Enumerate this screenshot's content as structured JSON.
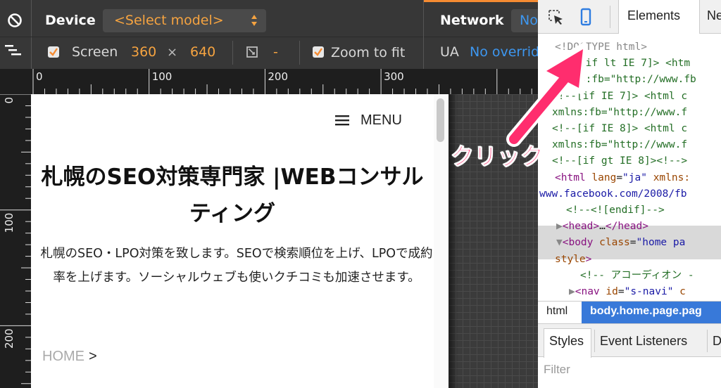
{
  "toolbar": {
    "device_label": "Device",
    "model_select": "<Select model>",
    "screen_label": "Screen",
    "screen_width": "360",
    "times": "×",
    "screen_height": "640",
    "scale_value": "-",
    "zoom_label": "Zoom to fit",
    "network_label": "Network",
    "network_value": "No",
    "ua_label": "UA",
    "ua_value": "No overrid",
    "icons": [
      "block-icon",
      "emulation-icon",
      "checkbox-icon",
      "zoom-icon"
    ]
  },
  "ruler": {
    "top_ticks": [
      "0",
      "100",
      "200",
      "300"
    ],
    "left_ticks": [
      "0",
      "100",
      "200"
    ]
  },
  "page": {
    "menu_label": "MENU",
    "title": "札幌のSEO対策専門家 |WEBコンサルティング",
    "description": "札幌のSEO・LPO対策を致します。SEOで検索順位を上げ、LPOで成約率を上げます。ソーシャルウェブも使いクチコミも加速させます。",
    "breadcrumb_home": "HOME",
    "breadcrumb_sep": ">"
  },
  "devtools": {
    "tab_elements": "Elements",
    "tab_network": "Ne",
    "code_lines": [
      {
        "parts": [
          [
            "c-gray",
            "<!DOCTYPE html>"
          ]
        ]
      },
      {
        "parts": [
          [
            "c-comment",
            "<!--[if lt IE 7]> <htm"
          ]
        ]
      },
      {
        "parts": [
          [
            "c-comment",
            "xmlns:fb=\"http://www.fb"
          ]
        ]
      },
      {
        "parts": [
          [
            "c-comment",
            "<!--[if IE 7]> <html c"
          ]
        ]
      },
      {
        "parts": [
          [
            "c-comment",
            "xmlns:fb=\"http://www.f"
          ]
        ]
      },
      {
        "parts": [
          [
            "c-comment",
            "<!--[if IE 8]> <html c"
          ]
        ]
      },
      {
        "parts": [
          [
            "c-comment",
            "xmlns:fb=\"http://www.f"
          ]
        ]
      },
      {
        "parts": [
          [
            "c-comment",
            "<!--[if gt IE 8]><!-->"
          ]
        ]
      },
      {
        "parts": [
          [
            "c-tag",
            "<html "
          ],
          [
            "c-attr",
            "lang"
          ],
          [
            "c-text",
            "="
          ],
          [
            "c-val",
            "\"ja\""
          ],
          [
            "c-attr",
            " xmlns:"
          ]
        ]
      },
      {
        "parts": [
          [
            "c-val",
            "www.facebook.com/2008/fb"
          ]
        ]
      },
      {
        "parts": [
          [
            "c-comment",
            "<!--<![endif]-->"
          ]
        ]
      },
      {
        "parts": [
          [
            "c-gray",
            "▶"
          ],
          [
            "c-tag",
            "<head>"
          ],
          [
            "c-text",
            "…"
          ],
          [
            "c-tag",
            "</head>"
          ]
        ]
      },
      {
        "parts": [
          [
            "c-gray",
            "▼"
          ],
          [
            "c-tag",
            "<body "
          ],
          [
            "c-attr",
            "class"
          ],
          [
            "c-text",
            "="
          ],
          [
            "c-val",
            "\"home pa"
          ]
        ]
      },
      {
        "parts": [
          [
            "c-attr",
            "style"
          ],
          [
            "c-tag",
            ">"
          ]
        ]
      },
      {
        "parts": [
          [
            "c-comment",
            "<!-- アコーディオン -"
          ]
        ]
      },
      {
        "parts": [
          [
            "c-gray",
            "▶"
          ],
          [
            "c-tag",
            "<nav "
          ],
          [
            "c-attr",
            "id"
          ],
          [
            "c-text",
            "="
          ],
          [
            "c-val",
            "\"s-navi\""
          ],
          [
            "c-attr",
            " c"
          ]
        ]
      }
    ],
    "crumb_html": "html",
    "crumb_body": "body.home.page.pag",
    "styles_tab": "Styles",
    "event_listeners_tab": "Event Listeners",
    "third_tab": "D",
    "filter_placeholder": "Filter"
  },
  "annotation": {
    "text": "クリック",
    "color": "#ff2d6e"
  },
  "colors": {
    "toolbar_bg": "#373737",
    "accent_orange": "#f5a340",
    "link_blue": "#3d97f0",
    "selection_blue": "#3879d9"
  }
}
